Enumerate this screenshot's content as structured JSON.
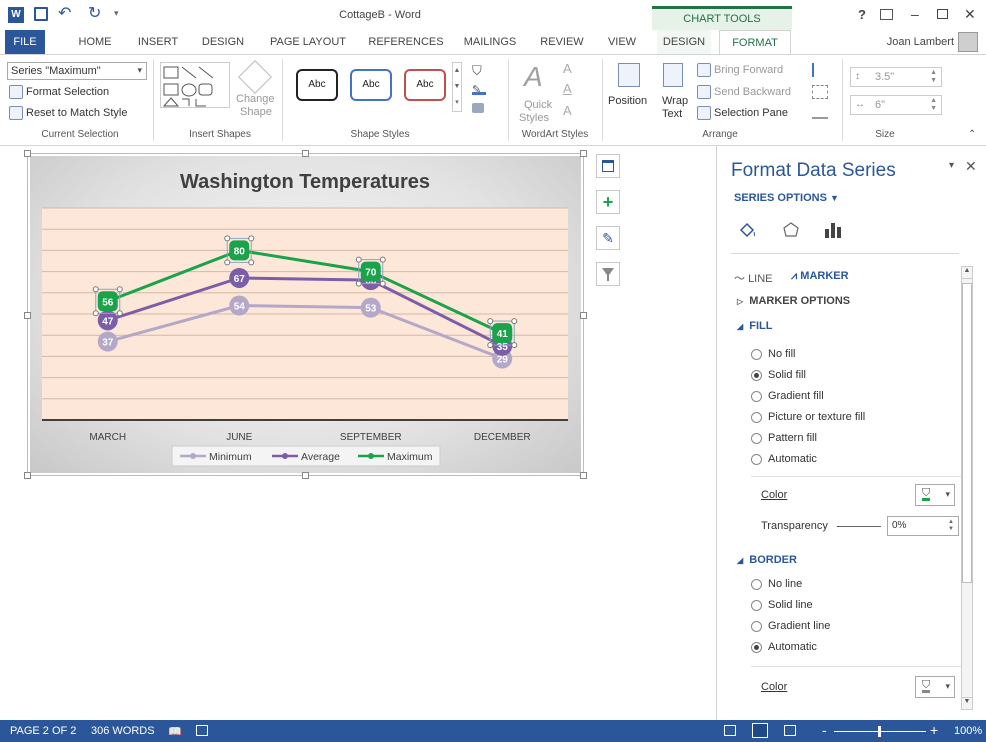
{
  "titlebar": {
    "title": "CottageB - Word",
    "context_tab": "CHART TOOLS",
    "help": "?",
    "minimize": "–",
    "close": "✕"
  },
  "tabs": [
    "FILE",
    "HOME",
    "INSERT",
    "DESIGN",
    "PAGE LAYOUT",
    "REFERENCES",
    "MAILINGS",
    "REVIEW",
    "VIEW",
    "DESIGN",
    "FORMAT"
  ],
  "user": "Joan Lambert",
  "ribbon": {
    "current_selection": {
      "dropdown_value": "Series \"Maximum\"",
      "format_selection": "Format Selection",
      "reset": "Reset to Match Style",
      "label": "Current Selection"
    },
    "insert_shapes": {
      "change_shape": "Change",
      "change_shape2": "Shape",
      "label": "Insert Shapes"
    },
    "shape_styles": {
      "styles": [
        "Abc",
        "Abc",
        "Abc"
      ],
      "label": "Shape Styles"
    },
    "wordart": {
      "quick": "Quick",
      "styles": "Styles",
      "label": "WordArt Styles"
    },
    "arrange": {
      "position": "Position",
      "wrap": "Wrap",
      "wrap2": "Text",
      "bring_forward": "Bring Forward",
      "send_backward": "Send Backward",
      "selection_pane": "Selection Pane",
      "label": "Arrange"
    },
    "size": {
      "height": "3.5\"",
      "width": "6\"",
      "label": "Size"
    }
  },
  "chart_data": {
    "type": "line",
    "title": "Washington Temperatures",
    "categories": [
      "MARCH",
      "JUNE",
      "SEPTEMBER",
      "DECEMBER"
    ],
    "series": [
      {
        "name": "Minimum",
        "values": [
          37,
          54,
          53,
          29
        ],
        "color": "#b3a8c8"
      },
      {
        "name": "Average",
        "values": [
          47,
          67,
          66,
          35
        ],
        "color": "#7b5ea7"
      },
      {
        "name": "Maximum",
        "values": [
          56,
          80,
          70,
          41
        ],
        "color": "#1aa34a"
      }
    ],
    "ylim": [
      0,
      100
    ],
    "grid": true,
    "legend": "bottom",
    "plot_bg": "#fde7d8"
  },
  "pane": {
    "title": "Format Data Series",
    "series_options": "SERIES OPTIONS",
    "line_tab": "LINE",
    "marker_tab": "MARKER",
    "marker_options": "MARKER OPTIONS",
    "fill": "FILL",
    "fill_options": [
      "No fill",
      "Solid fill",
      "Gradient fill",
      "Picture or texture fill",
      "Pattern fill",
      "Automatic"
    ],
    "fill_selected": 1,
    "color": "Color",
    "transparency": "Transparency",
    "transparency_value": "0%",
    "border": "BORDER",
    "border_options": [
      "No line",
      "Solid line",
      "Gradient line",
      "Automatic"
    ],
    "border_selected": 3,
    "border_color": "Color"
  },
  "status": {
    "page": "PAGE 2 OF 2",
    "words": "306 WORDS",
    "zoom": "100%"
  },
  "colors": {
    "accent": "#2b579a",
    "context": "#217346"
  }
}
